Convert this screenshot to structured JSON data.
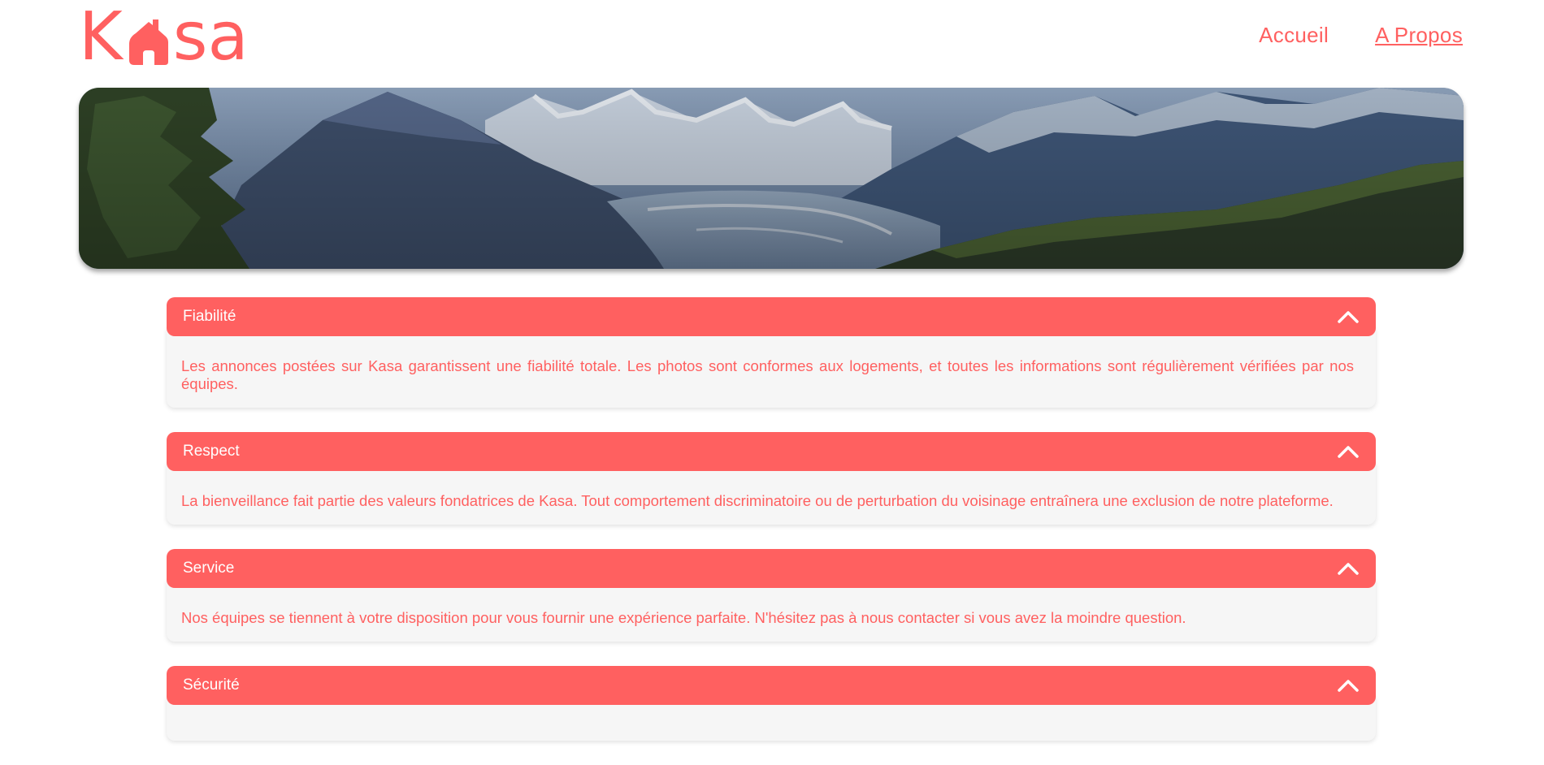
{
  "brand": {
    "logo_text_left": "K",
    "logo_text_right": "sa",
    "logo_full": "Kasa",
    "color": "#FF6060"
  },
  "nav": {
    "items": [
      {
        "label": "Accueil",
        "active": false
      },
      {
        "label": "A Propos",
        "active": true
      }
    ]
  },
  "banner": {
    "image": "mountain-landscape"
  },
  "sections": [
    {
      "title": "Fiabilité",
      "text": "Les annonces postées sur Kasa garantissent une fiabilité totale. Les photos sont conformes aux logements, et toutes les informations sont régulièrement vérifiées par nos équipes.",
      "icon": "chevron-up-icon"
    },
    {
      "title": "Respect",
      "text": "La bienveillance fait partie des valeurs fondatrices de Kasa. Tout comportement discriminatoire ou de perturbation du voisinage entraînera une exclusion de notre plateforme.",
      "icon": "chevron-up-icon"
    },
    {
      "title": "Service",
      "text": "Nos équipes se tiennent à votre disposition pour vous fournir une expérience parfaite. N'hésitez pas à nous contacter si vous avez la moindre question.",
      "icon": "chevron-up-icon"
    },
    {
      "title": "Sécurité",
      "text": "",
      "icon": "chevron-up-icon"
    }
  ],
  "colors": {
    "accent": "#FF6060",
    "panel_bg": "#F6F6F6",
    "header_text": "#FFFFFF"
  }
}
